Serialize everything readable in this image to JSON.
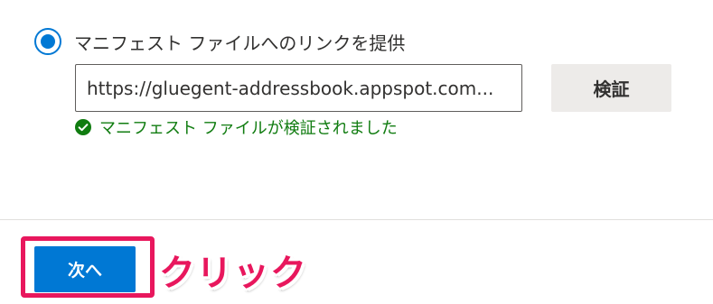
{
  "manifest_option": {
    "label": "マニフェスト ファイルへのリンクを提供",
    "selected": true
  },
  "manifest_url": {
    "value": "https://gluegent-addressbook.appspot.com..."
  },
  "verify_button": {
    "label": "検証"
  },
  "validation": {
    "icon": "check-circle-icon",
    "message": "マニフェスト ファイルが検証されました"
  },
  "footer": {
    "next_label": "次へ"
  },
  "annotation": {
    "callout_text": "クリック"
  },
  "colors": {
    "accent": "#0078d4",
    "success": "#107c10",
    "annotation": "#e8175d"
  }
}
